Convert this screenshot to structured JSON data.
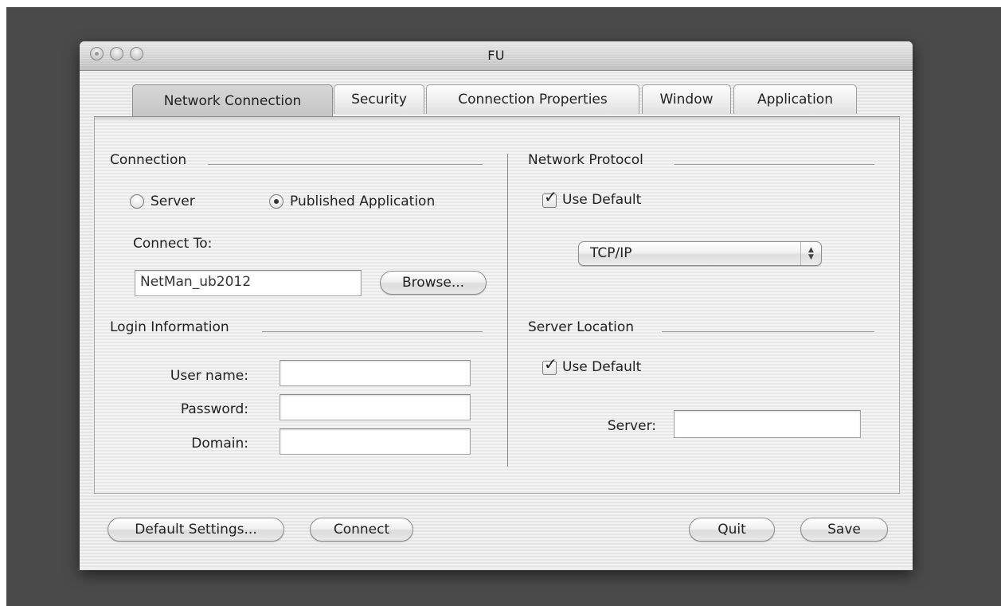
{
  "window": {
    "title": "FU"
  },
  "tabs": [
    {
      "label": "Network Connection",
      "active": true
    },
    {
      "label": "Security",
      "active": false
    },
    {
      "label": "Connection Properties",
      "active": false
    },
    {
      "label": "Window",
      "active": false
    },
    {
      "label": "Application",
      "active": false
    }
  ],
  "connection": {
    "group_title": "Connection",
    "radio_server": {
      "label": "Server",
      "selected": false
    },
    "radio_published": {
      "label": "Published Application",
      "selected": true
    },
    "connect_to_label": "Connect To:",
    "connect_to_value": "NetMan_ub2012",
    "browse_label": "Browse..."
  },
  "login": {
    "group_title": "Login Information",
    "username_label": "User name:",
    "username_value": "",
    "password_label": "Password:",
    "password_value": "",
    "domain_label": "Domain:",
    "domain_value": ""
  },
  "network_protocol": {
    "group_title": "Network Protocol",
    "use_default_label": "Use Default",
    "use_default_checked": true,
    "protocol_value": "TCP/IP"
  },
  "server_location": {
    "group_title": "Server Location",
    "use_default_label": "Use Default",
    "use_default_checked": true,
    "server_label": "Server:",
    "server_value": ""
  },
  "footer": {
    "default_settings_label": "Default Settings...",
    "connect_label": "Connect",
    "quit_label": "Quit",
    "save_label": "Save"
  },
  "icons": {
    "checkmark": "✓",
    "popup_up": "▲",
    "popup_down": "▼"
  }
}
